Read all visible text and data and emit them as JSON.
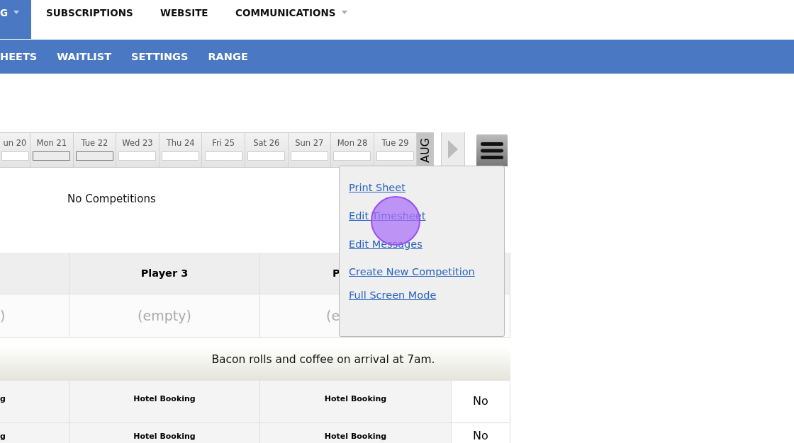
{
  "top_nav": [
    {
      "label": "G",
      "selected": true,
      "dropdown": true
    },
    {
      "label": "SUBSCRIPTIONS",
      "selected": false,
      "dropdown": false
    },
    {
      "label": "WEBSITE",
      "selected": false,
      "dropdown": false
    },
    {
      "label": "COMMUNICATIONS",
      "selected": false,
      "dropdown": true
    }
  ],
  "sub_nav": [
    {
      "label": "HEETS"
    },
    {
      "label": "WAITLIST"
    },
    {
      "label": "SETTINGS"
    },
    {
      "label": "RANGE"
    }
  ],
  "date_strip": {
    "days": [
      {
        "label": "un 20",
        "marked": false
      },
      {
        "label": "Mon 21",
        "marked": true
      },
      {
        "label": "Tue 22",
        "marked": true
      },
      {
        "label": "Wed 23",
        "marked": false
      },
      {
        "label": "Thu 24",
        "marked": false
      },
      {
        "label": "Fri 25",
        "marked": false
      },
      {
        "label": "Sat 26",
        "marked": false
      },
      {
        "label": "Sun 27",
        "marked": false
      },
      {
        "label": "Mon 28",
        "marked": false
      },
      {
        "label": "Tue 29",
        "marked": false
      }
    ],
    "month": "AUG"
  },
  "status_text": "No Competitions",
  "table": {
    "columns": [
      {},
      {
        "label": "Player 3"
      },
      {
        "label": "P"
      },
      {}
    ],
    "empty_row": [
      ")",
      "(empty)",
      "(e"
    ],
    "message": "Bacon rolls and coffee on arrival at 7am.",
    "rows": [
      {
        "cells": [
          "g",
          "Hotel Booking",
          "Hotel Booking",
          "No"
        ]
      },
      {
        "cells": [
          "g",
          "Hotel Booking",
          "Hotel Booking",
          "No"
        ]
      }
    ]
  },
  "menu": {
    "items": [
      "Print Sheet",
      "Edit Timesheet",
      "Edit Messages",
      "Create New Competition",
      "Full Screen Mode"
    ]
  }
}
